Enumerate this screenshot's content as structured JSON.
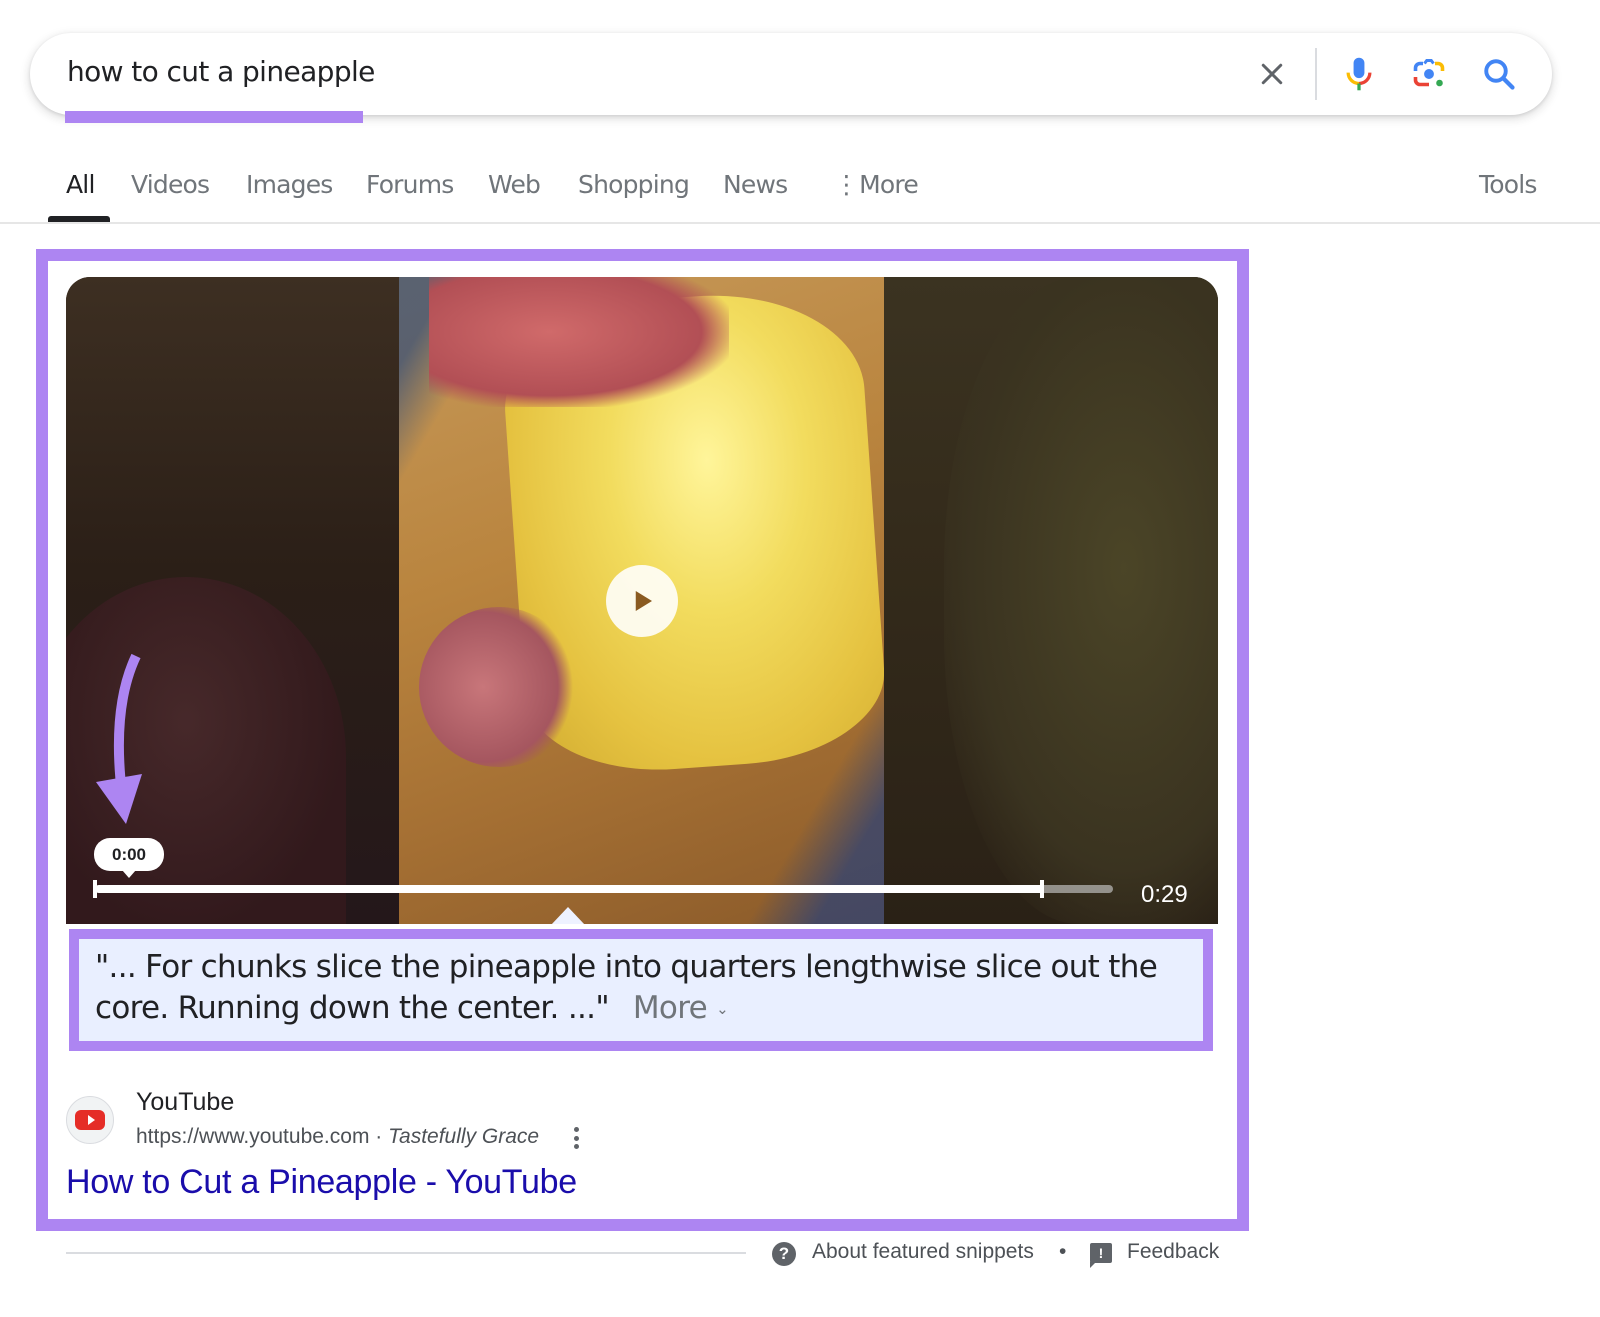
{
  "search": {
    "query": "how to cut a pineapple",
    "icons": [
      "clear-icon",
      "voice-search-icon",
      "lens-icon",
      "search-icon"
    ]
  },
  "tabs": [
    {
      "label": "All",
      "active": true
    },
    {
      "label": "Videos",
      "active": false
    },
    {
      "label": "Images",
      "active": false
    },
    {
      "label": "Forums",
      "active": false
    },
    {
      "label": "Web",
      "active": false
    },
    {
      "label": "Shopping",
      "active": false
    },
    {
      "label": "News",
      "active": false
    },
    {
      "label": "More",
      "active": false
    }
  ],
  "tools_label": "Tools",
  "video": {
    "current_time": "0:00",
    "duration": "0:29",
    "progress_fraction": 0.93
  },
  "transcript": {
    "text": "\"... For chunks slice the pineapple into quarters lengthwise slice out the core. Running down the center. ...\"",
    "more_label": "More",
    "more_chevron": "⌄"
  },
  "source": {
    "site_name": "YouTube",
    "url": "https://www.youtube.com",
    "separator": " · ",
    "author": "Tastefully Grace",
    "title": "How to Cut a Pineapple - YouTube"
  },
  "footer": {
    "about_icon": "?",
    "about_label": "About featured snippets",
    "separator": "•",
    "feedback_icon": "!",
    "feedback_label": "Feedback"
  },
  "colors": {
    "highlight": "#ad85f2",
    "link": "#1a0dab",
    "transcript_bg": "#e9efff"
  }
}
